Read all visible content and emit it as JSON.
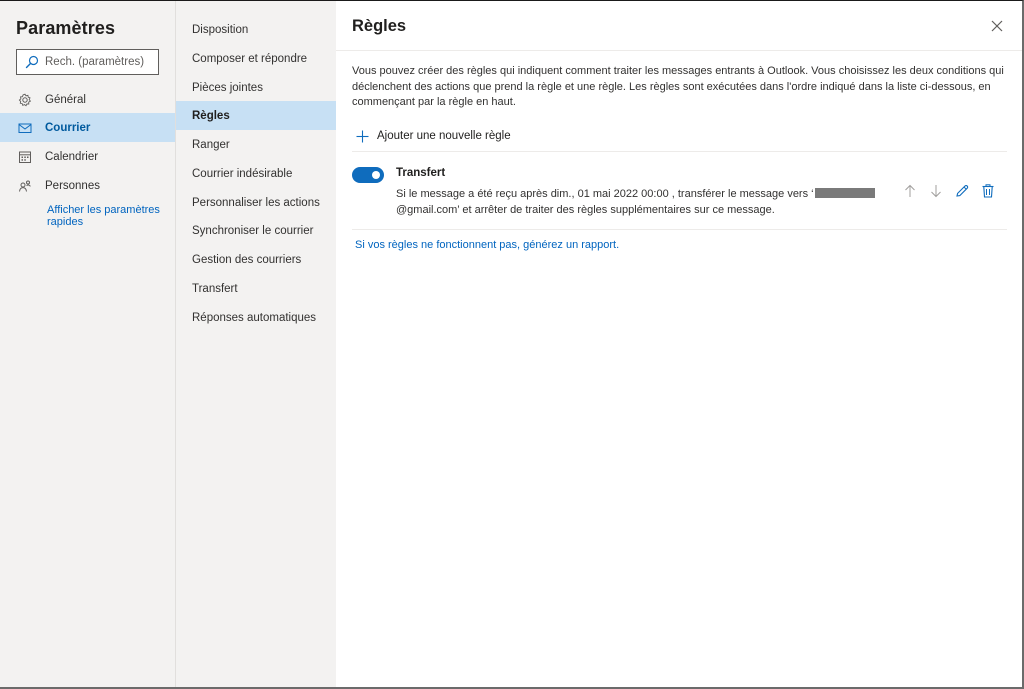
{
  "settings": {
    "title": "Paramètres",
    "search_placeholder": "Rech. (paramètres)",
    "nav": [
      {
        "label": "Général",
        "icon": "gear-icon"
      },
      {
        "label": "Courrier",
        "icon": "mail-icon",
        "active": true
      },
      {
        "label": "Calendrier",
        "icon": "calendar-icon"
      },
      {
        "label": "Personnes",
        "icon": "people-icon"
      }
    ],
    "quick_settings_link": "Afficher les paramètres rapides"
  },
  "mail_subnav": [
    "Disposition",
    "Composer et répondre",
    "Pièces jointes",
    "Règles",
    "Ranger",
    "Courrier indésirable",
    "Personnaliser les actions",
    "Synchroniser le courrier",
    "Gestion des courriers",
    "Transfert",
    "Réponses automatiques"
  ],
  "active_subnav": "Règles",
  "rules_panel": {
    "heading": "Règles",
    "description": "Vous pouvez créer des règles qui indiquent comment traiter les messages entrants à Outlook. Vous choisissez les deux conditions qui déclenchent des actions que prend la règle et une règle. Les règles sont exécutées dans l'ordre indiqué dans la liste ci-dessous, en commençant par la règle en haut.",
    "add_rule_label": "Ajouter une nouvelle règle",
    "rules": [
      {
        "name": "Transfert",
        "enabled": true,
        "description_part1": "Si le message a été reçu après dim., 01 mai 2022 00:00 , transférer le message vers ‘",
        "description_part2": "@gmail.com’ et arrêter de traiter des règles supplémentaires sur ce message."
      }
    ],
    "report_link": "Si vos règles ne fonctionnent pas, générez un rapport."
  },
  "colors": {
    "accent": "#0f6cbd",
    "link": "#0064bf",
    "selected_bg": "#c7e0f4",
    "pane_bg": "#f3f2f1"
  }
}
